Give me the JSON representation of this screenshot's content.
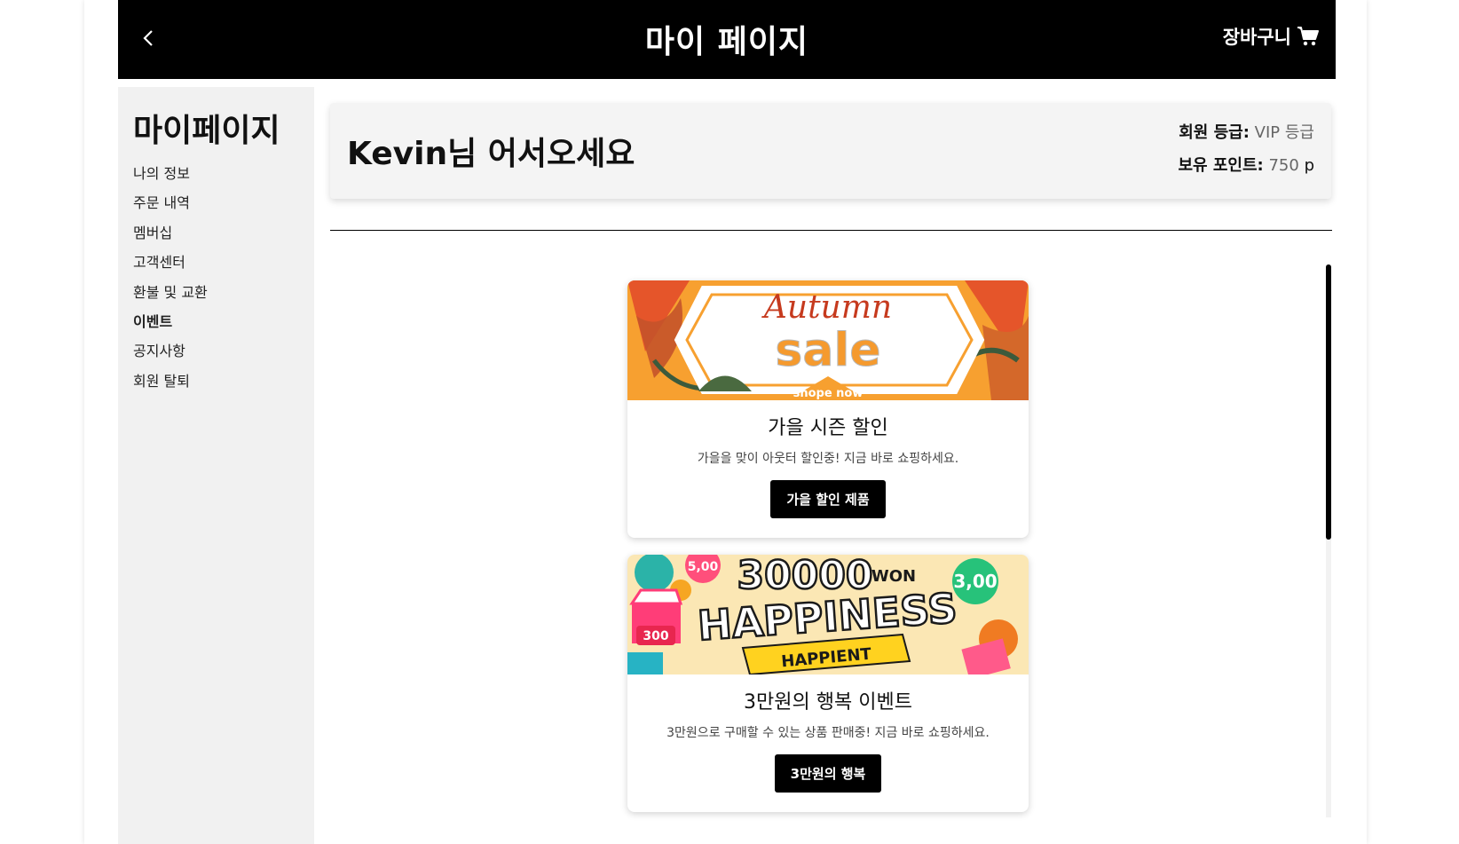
{
  "header": {
    "title": "마이 페이지",
    "cart_label": "장바구니"
  },
  "sidebar": {
    "title": "마이페이지",
    "items": [
      {
        "label": "나의 정보"
      },
      {
        "label": "주문 내역"
      },
      {
        "label": "멤버십"
      },
      {
        "label": "고객센터"
      },
      {
        "label": "환불 및 교환"
      },
      {
        "label": "이벤트",
        "active": true
      },
      {
        "label": "공지사항"
      },
      {
        "label": "회원 탈퇴"
      }
    ]
  },
  "welcome": {
    "greeting": "Kevin님 어서오세요",
    "grade_label": "회원 등급:",
    "grade_value": "VIP 등급",
    "points_label": "보유 포인트:",
    "points_value": "750",
    "points_unit": "p"
  },
  "events": [
    {
      "banner": {
        "script": "Autumn",
        "headline": "sale",
        "tag": "shope now"
      },
      "title": "가을 시즌 할인",
      "description": "가을을 맞이 아웃터 할인중! 지금 바로 쇼핑하세요.",
      "button": "가을 할인 제품"
    },
    {
      "banner": {
        "big_number": "30000",
        "unit": "WON",
        "headline": "HAPPINESS",
        "ribbon": "HAPPIENT",
        "badge_left": "5,00",
        "badge_right": "3,00",
        "tag_left": "300"
      },
      "title": "3만원의 행복 이벤트",
      "description": "3만원으로 구매할 수 있는 상품 판매중! 지금 바로 쇼핑하세요.",
      "button": "3만원의 행복"
    }
  ],
  "colors": {
    "header_bg": "#000000",
    "sidebar_bg": "#f1f1f1",
    "autumn_orange": "#f7a030",
    "scroll_thumb": "#000000"
  }
}
